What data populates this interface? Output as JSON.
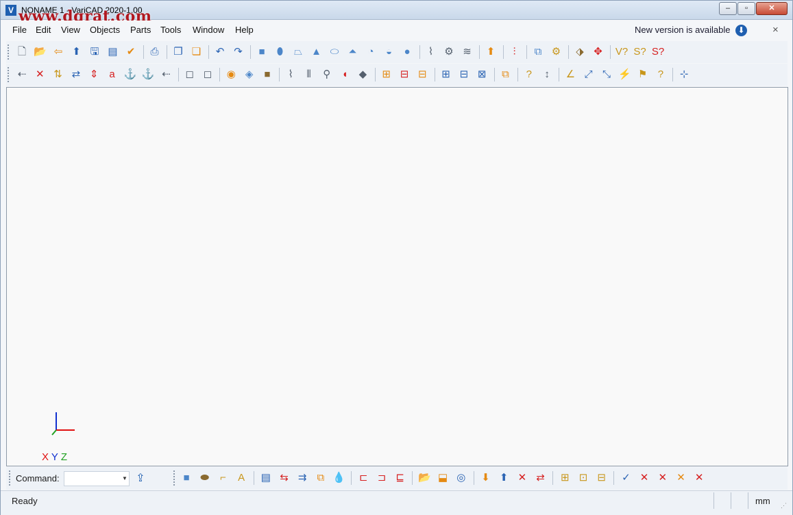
{
  "window": {
    "title": "NONAME 1 - VariCAD 2020-1.00",
    "watermark": "www.dgrat.com",
    "app_icon_letter": "V",
    "controls": {
      "minimize": "–",
      "maximize": "▫",
      "close": "✕"
    }
  },
  "menu": {
    "items": [
      {
        "label": "File"
      },
      {
        "label": "Edit"
      },
      {
        "label": "View"
      },
      {
        "label": "Objects"
      },
      {
        "label": "Parts"
      },
      {
        "label": "Tools"
      },
      {
        "label": "Window"
      },
      {
        "label": "Help"
      }
    ],
    "new_version": "New version is available",
    "download_icon": "⬇",
    "close": "×"
  },
  "toolbar1_icons": [
    {
      "name": "new-file-icon",
      "glyph": "🗋",
      "color": "c-gray"
    },
    {
      "name": "open-file-icon",
      "glyph": "📂",
      "color": "c-orange"
    },
    {
      "name": "open-recent-icon",
      "glyph": "⇦",
      "color": "c-orange"
    },
    {
      "name": "insert-file-icon",
      "glyph": "⬆",
      "color": "c-blue"
    },
    {
      "name": "save-icon",
      "glyph": "🖫",
      "color": "c-blue"
    },
    {
      "name": "save-all-icon",
      "glyph": "▤",
      "color": "c-blue"
    },
    {
      "name": "save-as-icon",
      "glyph": "✔",
      "color": "c-orange"
    },
    {
      "name": "print-icon",
      "glyph": "⎙",
      "color": "c-blue"
    },
    {
      "name": "copy-icon",
      "glyph": "❐",
      "color": "c-blue"
    },
    {
      "name": "paste-icon",
      "glyph": "❏",
      "color": "c-orange"
    },
    {
      "name": "undo-icon",
      "glyph": "↶",
      "color": "c-blue"
    },
    {
      "name": "redo-icon",
      "glyph": "↷",
      "color": "c-blue"
    },
    {
      "name": "box-solid-icon",
      "glyph": "■",
      "color": "c-steel"
    },
    {
      "name": "cylinder-solid-icon",
      "glyph": "⬮",
      "color": "c-steel"
    },
    {
      "name": "prism-solid-icon",
      "glyph": "⏢",
      "color": "c-steel"
    },
    {
      "name": "cone-solid-icon",
      "glyph": "▲",
      "color": "c-steel"
    },
    {
      "name": "pipe-solid-icon",
      "glyph": "⬭",
      "color": "c-steel"
    },
    {
      "name": "truncated-cone-icon",
      "glyph": "⏶",
      "color": "c-steel"
    },
    {
      "name": "elbow-solid-icon",
      "glyph": "◔",
      "color": "c-steel"
    },
    {
      "name": "torus-solid-icon",
      "glyph": "◒",
      "color": "c-steel"
    },
    {
      "name": "sphere-solid-icon",
      "glyph": "●",
      "color": "c-steel"
    },
    {
      "name": "thread-icon",
      "glyph": "⌇",
      "color": "c-gray"
    },
    {
      "name": "spring-icon",
      "glyph": "⚙",
      "color": "c-gray"
    },
    {
      "name": "helix-icon",
      "glyph": "≋",
      "color": "c-gray"
    },
    {
      "name": "extrude-icon",
      "glyph": "⬆",
      "color": "c-orange"
    },
    {
      "name": "bool-icon",
      "glyph": "⫶",
      "color": "c-red"
    },
    {
      "name": "section-icon",
      "glyph": "⧉",
      "color": "c-steel"
    },
    {
      "name": "view-options-icon",
      "glyph": "⚙",
      "color": "c-gold"
    },
    {
      "name": "assembly-icon",
      "glyph": "⬗",
      "color": "c-brown"
    },
    {
      "name": "explode-icon",
      "glyph": "✥",
      "color": "c-red"
    },
    {
      "name": "volume-query-icon",
      "glyph": "V?",
      "color": "c-gold"
    },
    {
      "name": "surface-query-icon",
      "glyph": "S?",
      "color": "c-gold"
    },
    {
      "name": "section-query-icon",
      "glyph": "S?",
      "color": "c-red"
    }
  ],
  "toolbar2_icons": [
    {
      "name": "select-icon",
      "glyph": "⇠",
      "color": "c-gray"
    },
    {
      "name": "delete-icon",
      "glyph": "✕",
      "color": "c-red"
    },
    {
      "name": "move-icon",
      "glyph": "⇅",
      "color": "c-gold"
    },
    {
      "name": "move-copy-icon",
      "glyph": "⇄",
      "color": "c-blue"
    },
    {
      "name": "mirror-icon",
      "glyph": "⇕",
      "color": "c-red"
    },
    {
      "name": "attributes-icon",
      "glyph": "a",
      "color": "c-red"
    },
    {
      "name": "anchor-icon",
      "glyph": "⚓",
      "color": "c-red"
    },
    {
      "name": "anchor-group-icon",
      "glyph": "⚓",
      "color": "c-brown"
    },
    {
      "name": "select-all-icon",
      "glyph": "⇠",
      "color": "c-gray"
    },
    {
      "name": "wireframe-box-icon",
      "glyph": "◻",
      "color": "c-gray"
    },
    {
      "name": "outline-box-icon",
      "glyph": "◻",
      "color": "c-gray"
    },
    {
      "name": "color-palette-icon",
      "glyph": "◉",
      "color": "c-orange"
    },
    {
      "name": "shading-icon",
      "glyph": "◈",
      "color": "c-steel"
    },
    {
      "name": "render-icon",
      "glyph": "■",
      "color": "c-brown"
    },
    {
      "name": "screw-icon",
      "glyph": "⌇",
      "color": "c-gray"
    },
    {
      "name": "bolt-icon",
      "glyph": "⫴",
      "color": "c-gray"
    },
    {
      "name": "pin-icon",
      "glyph": "⚲",
      "color": "c-gray"
    },
    {
      "name": "fillet-icon",
      "glyph": "◖",
      "color": "c-red"
    },
    {
      "name": "chamfer-icon",
      "glyph": "◆",
      "color": "c-gray"
    },
    {
      "name": "add-to-set-icon",
      "glyph": "⊞",
      "color": "c-orange"
    },
    {
      "name": "remove-from-set-icon",
      "glyph": "⊟",
      "color": "c-red"
    },
    {
      "name": "set-subtract-icon",
      "glyph": "⊟",
      "color": "c-orange"
    },
    {
      "name": "union-icon",
      "glyph": "⊞",
      "color": "c-blue"
    },
    {
      "name": "difference-icon",
      "glyph": "⊟",
      "color": "c-blue"
    },
    {
      "name": "intersection-icon",
      "glyph": "⊠",
      "color": "c-blue"
    },
    {
      "name": "clone-set-icon",
      "glyph": "⧉",
      "color": "c-orange"
    },
    {
      "name": "query-solid-icon",
      "glyph": "?",
      "color": "c-gold"
    },
    {
      "name": "distance-query-icon",
      "glyph": "↕",
      "color": "c-gray"
    },
    {
      "name": "angle-query-icon",
      "glyph": "∠",
      "color": "c-gold"
    },
    {
      "name": "position-query-icon",
      "glyph": "⤢",
      "color": "c-blue"
    },
    {
      "name": "measure-icon",
      "glyph": "⤡",
      "color": "c-blue"
    },
    {
      "name": "edge-query-icon",
      "glyph": "⚡",
      "color": "c-gold"
    },
    {
      "name": "face-query-icon",
      "glyph": "⚑",
      "color": "c-gold"
    },
    {
      "name": "solid-query-icon",
      "glyph": "?",
      "color": "c-gold"
    },
    {
      "name": "coordinate-system-icon",
      "glyph": "⊹",
      "color": "c-blue"
    }
  ],
  "axes_label": {
    "x": "X",
    "y": "Y",
    "z": "Z"
  },
  "command": {
    "label": "Command:",
    "value": "",
    "dropdown": "▼",
    "send_icon": "⇪"
  },
  "command_icons": [
    {
      "name": "solid-box-icon",
      "glyph": "■",
      "color": "c-steel"
    },
    {
      "name": "pipe-bend-icon",
      "glyph": "⬬",
      "color": "c-brown"
    },
    {
      "name": "sweep-icon",
      "glyph": "⌐",
      "color": "c-gold"
    },
    {
      "name": "text-solid-icon",
      "glyph": "A",
      "color": "c-gold"
    },
    {
      "name": "bom-icon",
      "glyph": "▤",
      "color": "c-blue"
    },
    {
      "name": "bom-edit-icon",
      "glyph": "⇆",
      "color": "c-red"
    },
    {
      "name": "bom-export-icon",
      "glyph": "⇉",
      "color": "c-blue"
    },
    {
      "name": "bom-report-icon",
      "glyph": "⧉",
      "color": "c-orange"
    },
    {
      "name": "water-drop-icon",
      "glyph": "💧",
      "color": "c-blue"
    },
    {
      "name": "tree-icon",
      "glyph": "⊏",
      "color": "c-red"
    },
    {
      "name": "tree-expand-icon",
      "glyph": "⊐",
      "color": "c-red"
    },
    {
      "name": "tree-collapse-icon",
      "glyph": "⊑",
      "color": "c-red"
    },
    {
      "name": "folder-open-icon",
      "glyph": "📂",
      "color": "c-blue"
    },
    {
      "name": "layer-icon",
      "glyph": "⬓",
      "color": "c-orange"
    },
    {
      "name": "rotate-view-icon",
      "glyph": "◎",
      "color": "c-blue"
    },
    {
      "name": "load-part-icon",
      "glyph": "⬇",
      "color": "c-orange"
    },
    {
      "name": "export-part-icon",
      "glyph": "⬆",
      "color": "c-blue"
    },
    {
      "name": "remove-part-icon",
      "glyph": "✕",
      "color": "c-red"
    },
    {
      "name": "replace-part-icon",
      "glyph": "⇄",
      "color": "c-red"
    },
    {
      "name": "group-add-icon",
      "glyph": "⊞",
      "color": "c-gold"
    },
    {
      "name": "group-up-icon",
      "glyph": "⊡",
      "color": "c-gold"
    },
    {
      "name": "group-down-icon",
      "glyph": "⊟",
      "color": "c-gold"
    },
    {
      "name": "check-constraint-icon",
      "glyph": "✓",
      "color": "c-blue"
    },
    {
      "name": "cancel-constraint-icon",
      "glyph": "✕",
      "color": "c-red"
    },
    {
      "name": "cancel-all-icon",
      "glyph": "✕",
      "color": "c-red"
    },
    {
      "name": "cancel-pending-icon",
      "glyph": "✕",
      "color": "c-orange"
    },
    {
      "name": "remove-constraint-icon",
      "glyph": "✕",
      "color": "c-red"
    }
  ],
  "status": {
    "text": "Ready",
    "units": "mm"
  }
}
